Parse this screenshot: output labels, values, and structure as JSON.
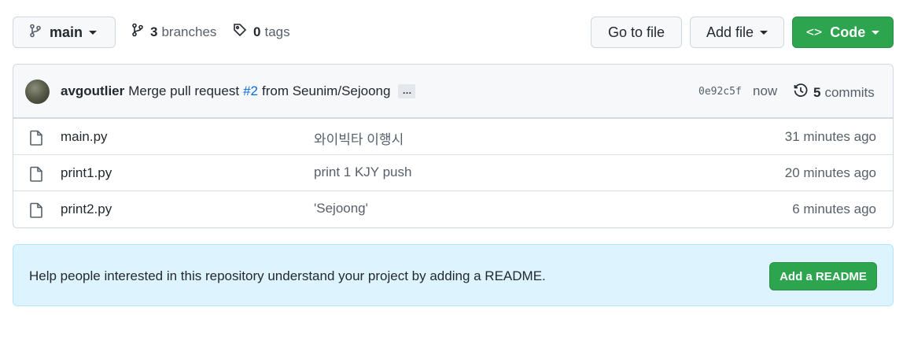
{
  "toolbar": {
    "branch": "main",
    "branches_count": "3",
    "branches_label": "branches",
    "tags_count": "0",
    "tags_label": "tags",
    "goto_file": "Go to file",
    "add_file": "Add file",
    "code": "Code",
    "code_glyph": "<>"
  },
  "commit": {
    "author": "avgoutlier",
    "message_prefix": "Merge pull request",
    "pr_link": "#2",
    "message_suffix": "from Seunim/Sejoong",
    "ellipsis": "…",
    "sha": "0e92c5f",
    "when": "now",
    "commits_count": "5",
    "commits_label": "commits"
  },
  "files": [
    {
      "name": "main.py",
      "message": "와이빅타 이행시",
      "age": "31 minutes ago"
    },
    {
      "name": "print1.py",
      "message": "print 1 KJY push",
      "age": "20 minutes ago"
    },
    {
      "name": "print2.py",
      "message": "'Sejoong'",
      "age": "6 minutes ago"
    }
  ],
  "readme": {
    "text": "Help people interested in this repository understand your project by adding a README.",
    "button": "Add a README"
  },
  "colors": {
    "primary_green": "#2da44e",
    "link_blue": "#0969da",
    "banner_bg": "#ddf4ff"
  },
  "icons": [
    "git-branch-icon",
    "tag-icon",
    "history-icon",
    "file-icon"
  ]
}
